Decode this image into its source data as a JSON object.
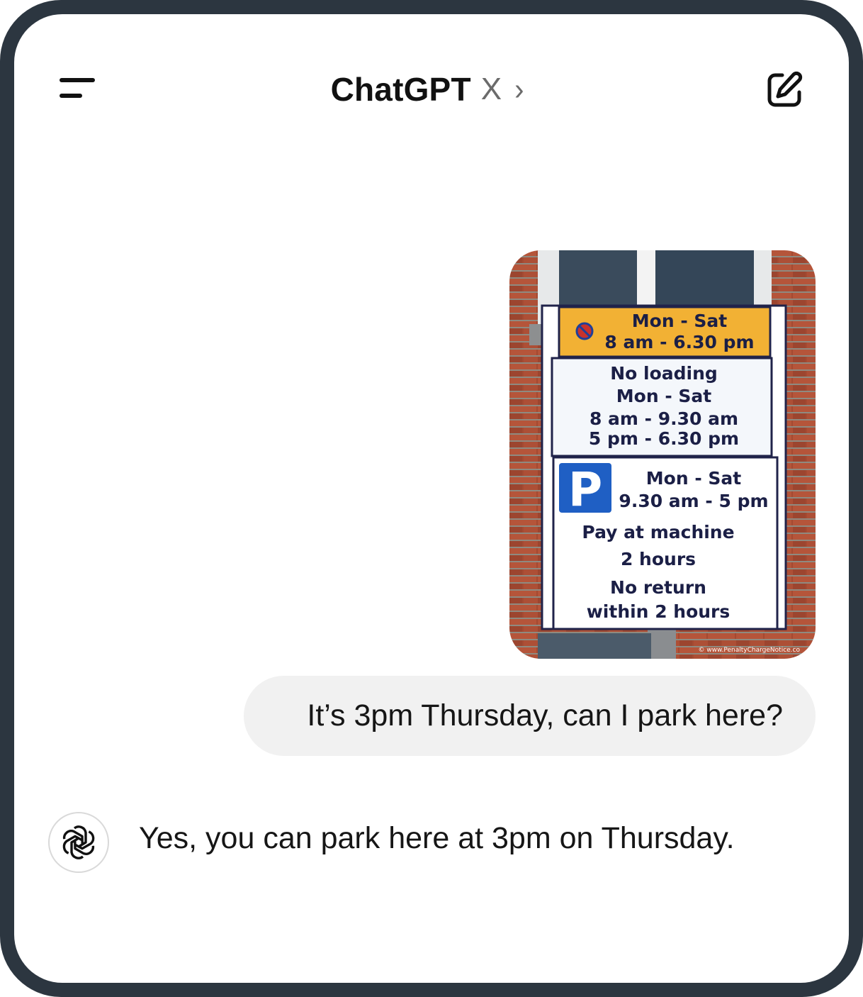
{
  "header": {
    "title": "ChatGPT",
    "model_suffix": "X",
    "chevron": "›",
    "menu_icon": "menu-icon",
    "compose_icon": "compose-icon"
  },
  "conversation": {
    "image": {
      "sign": {
        "top_panel": [
          "Mon - Sat",
          "8 am - 6.30 pm"
        ],
        "loading_panel": [
          "No loading",
          "Mon - Sat",
          "8 am - 9.30 am",
          "5 pm - 6.30 pm"
        ],
        "parking_symbol": "P",
        "parking_times": [
          "Mon - Sat",
          "9.30 am - 5 pm"
        ],
        "parking_rules": [
          "Pay at machine",
          "2 hours",
          "No return",
          "within 2 hours"
        ],
        "watermark": "© www.PenaltyChargeNotice.co"
      }
    },
    "user_message": "It’s 3pm Thursday, can I park here?",
    "assistant_message": "Yes, you can park here at 3pm on Thursday."
  },
  "colors": {
    "frame": "#2c3640",
    "bubble": "#f1f1f1",
    "sign_yellow": "#f2b134",
    "sign_blue": "#1f5fc4"
  }
}
